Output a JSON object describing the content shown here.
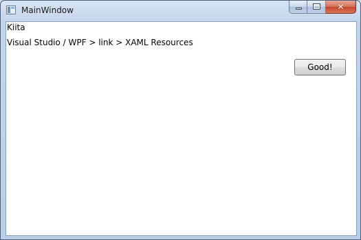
{
  "window": {
    "title": "MainWindow",
    "icon": "app-window-icon",
    "buttons": {
      "minimize": "minimize-icon",
      "maximize": "maximize-icon",
      "close": "close-icon"
    }
  },
  "content": {
    "line1": "Kiita",
    "line2": "Visual Studio / WPF > link > XAML Resources",
    "button_label": "Good!"
  },
  "colors": {
    "titlebar": "#c5d6ea",
    "client_bg": "#ffffff",
    "close_button": "#c5452b"
  }
}
